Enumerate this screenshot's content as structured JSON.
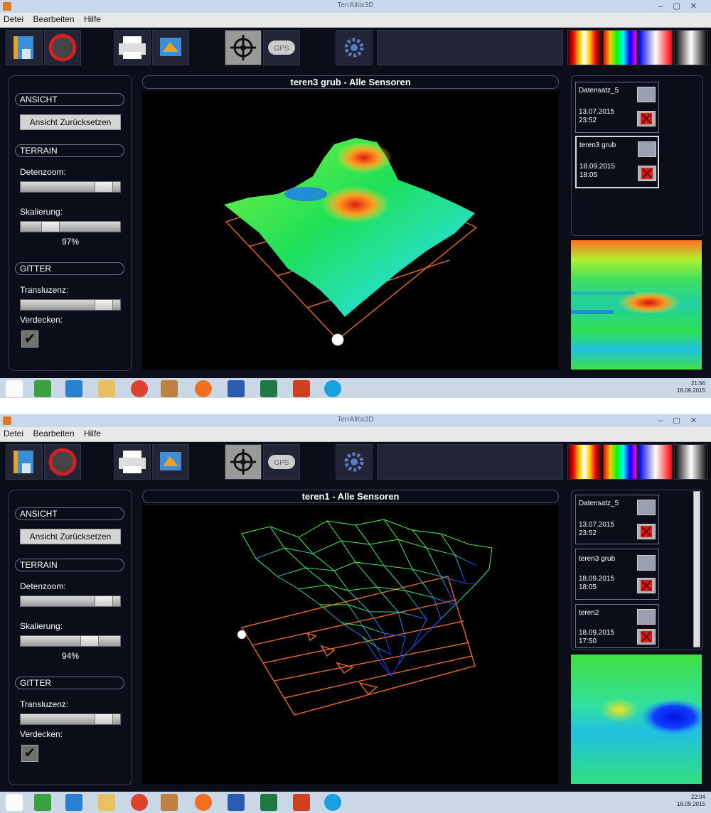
{
  "windows": [
    {
      "title": "TerrAlitix3D",
      "menu": [
        "Detei",
        "Bearbeiten",
        "Hilfe"
      ],
      "view_title": "teren3 grub - Alle Sensoren",
      "left_panel": {
        "ansicht_header": "ANSICHT",
        "reset_button": "Ansicht Zurücksetzen",
        "terrain_header": "TERRAIN",
        "datenzoom_label": "Detenzoom:",
        "datenzoom_value": 0.9,
        "skalierung_label": "Skalierung:",
        "skalierung_value": 0.25,
        "skalierung_pct": "97%",
        "gitter_header": "GITTER",
        "transluzenz_label": "Transluzenz:",
        "transluzenz_value": 0.9,
        "verdecken_label": "Verdecken:",
        "verdecken_checked": true
      },
      "datasets": [
        {
          "name": "Datensatz_5",
          "date": "13.07.2015",
          "time": "23:52"
        },
        {
          "name": "teren3 grub",
          "date": "18.09.2015",
          "time": "18:05"
        }
      ],
      "selected_dataset": 1,
      "tray_time": "21:56",
      "tray_date": "18.09.2015"
    },
    {
      "title": "TerrAlitix3D",
      "menu": [
        "Detei",
        "Bearbeiten",
        "Hilfe"
      ],
      "view_title": "teren1 - Alle Sensoren",
      "left_panel": {
        "ansicht_header": "ANSICHT",
        "reset_button": "Ansicht Zurücksetzen",
        "terrain_header": "TERRAIN",
        "datenzoom_label": "Detenzoom:",
        "datenzoom_value": 0.9,
        "skalierung_label": "Skalierung:",
        "skalierung_value": 0.72,
        "skalierung_pct": "94%",
        "gitter_header": "GITTER",
        "transluzenz_label": "Transluzenz:",
        "transluzenz_value": 0.9,
        "verdecken_label": "Verdecken:",
        "verdecken_checked": true
      },
      "datasets": [
        {
          "name": "Datensatz_5",
          "date": "13.07.2015",
          "time": "23:52"
        },
        {
          "name": "teren3 grub",
          "date": "18.09.2015",
          "time": "18:05"
        },
        {
          "name": "teren2",
          "date": "18.09.2015",
          "time": "17:50"
        }
      ],
      "selected_dataset": -1,
      "tray_time": "22:04",
      "tray_date": "18.09.2015"
    }
  ],
  "colors": {
    "background": "#0b0d18",
    "panel_border": "#3b3f55",
    "grid_lines": "#d9652b",
    "mesh_high": "#4cff3a",
    "mesh_low": "#1030ff"
  },
  "icons": {
    "toolbar": [
      "open-file-icon",
      "record-icon",
      "print-icon",
      "export-icon",
      "crosshair-icon",
      "gps-icon",
      "settings-icon"
    ],
    "palettes": [
      "palette-hot-icon",
      "palette-rainbow-icon",
      "palette-blue-red-icon",
      "palette-grayscale-icon"
    ]
  }
}
